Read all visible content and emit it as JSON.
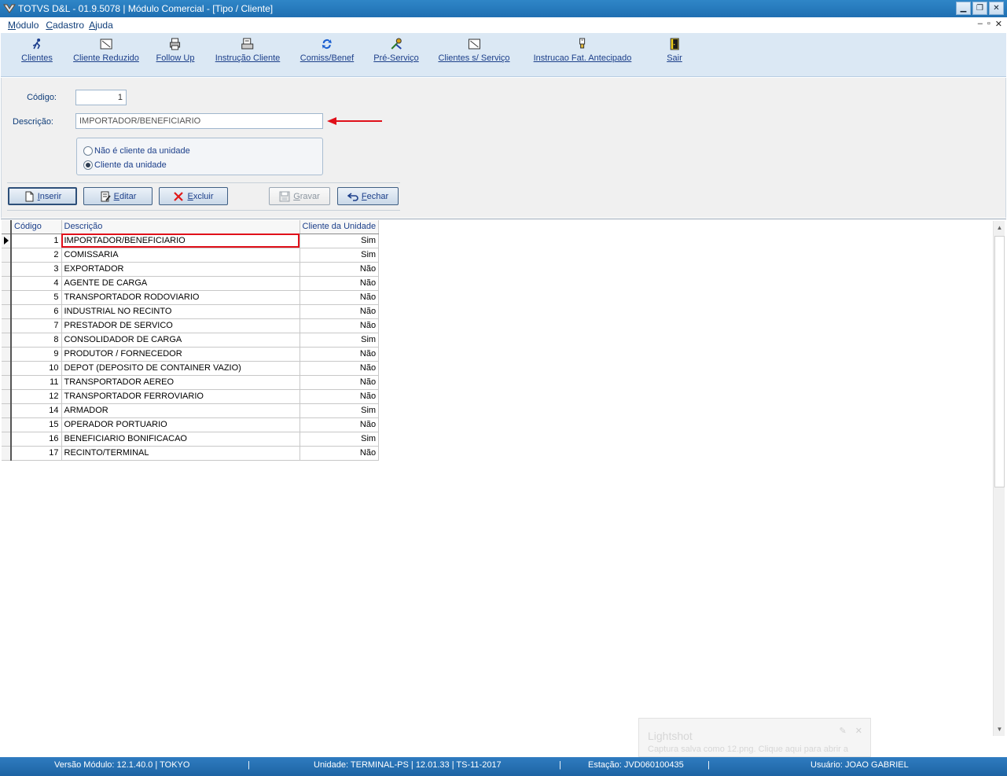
{
  "window": {
    "title": "TOTVS D&L - 01.9.5078 | Módulo Comercial - [Tipo / Cliente]",
    "buttons": {
      "minimize": "▁",
      "restore": "❐",
      "close": "✕"
    }
  },
  "menu": {
    "items": [
      {
        "accel": "M",
        "rest": "ódulo"
      },
      {
        "accel": "C",
        "rest": "adastro"
      },
      {
        "accel": "A",
        "rest": "juda"
      }
    ],
    "mdi": {
      "minimize": "–",
      "restore": "▫",
      "close": "✕"
    }
  },
  "toolbar": {
    "items": [
      {
        "label": "Clientes",
        "icon": "person-run-icon"
      },
      {
        "label": "Cliente Reduzido",
        "icon": "window-icon"
      },
      {
        "label": "Follow Up",
        "icon": "printer-icon"
      },
      {
        "label": "Instrução Cliente",
        "icon": "document-print-icon"
      },
      {
        "label": "Comiss/Benef",
        "icon": "refresh-icon"
      },
      {
        "label": "Pré-Serviço",
        "icon": "tools-icon"
      },
      {
        "label": "Clientes s/ Serviço",
        "icon": "window-icon"
      },
      {
        "label": "Instrucao Fat. Antecipado",
        "icon": "stamp-icon"
      },
      {
        "label": "Sair",
        "icon": "exit-door-icon"
      }
    ]
  },
  "form": {
    "codigo_label": "Código:",
    "codigo_value": "1",
    "descricao_label": "Descrição:",
    "descricao_value": "IMPORTADOR/BENEFICIARIO",
    "radio_options": [
      {
        "label": "Não é cliente da unidade",
        "checked": false
      },
      {
        "label": "Cliente da unidade",
        "checked": true
      }
    ]
  },
  "actions": {
    "inserir": {
      "accel": "I",
      "rest": "nserir"
    },
    "editar": {
      "accel": "E",
      "rest": "ditar"
    },
    "excluir": {
      "accel": "E",
      "rest": "xcluir"
    },
    "gravar": {
      "accel": "G",
      "rest": "ravar"
    },
    "fechar": {
      "accel": "F",
      "rest": "echar"
    }
  },
  "grid": {
    "columns": [
      "Código",
      "Descrição",
      "Cliente da Unidade"
    ],
    "rows": [
      {
        "codigo": "1",
        "descricao": "IMPORTADOR/BENEFICIARIO",
        "cliente": "Sim"
      },
      {
        "codigo": "2",
        "descricao": "COMISSARIA",
        "cliente": "Sim"
      },
      {
        "codigo": "3",
        "descricao": "EXPORTADOR",
        "cliente": "Não"
      },
      {
        "codigo": "4",
        "descricao": "AGENTE DE CARGA",
        "cliente": "Não"
      },
      {
        "codigo": "5",
        "descricao": "TRANSPORTADOR RODOVIARIO",
        "cliente": "Não"
      },
      {
        "codigo": "6",
        "descricao": "INDUSTRIAL NO RECINTO",
        "cliente": "Não"
      },
      {
        "codigo": "7",
        "descricao": "PRESTADOR DE SERVICO",
        "cliente": "Não"
      },
      {
        "codigo": "8",
        "descricao": "CONSOLIDADOR DE CARGA",
        "cliente": "Sim"
      },
      {
        "codigo": "9",
        "descricao": "PRODUTOR / FORNECEDOR",
        "cliente": "Não"
      },
      {
        "codigo": "10",
        "descricao": "DEPOT (DEPOSITO DE CONTAINER VAZIO)",
        "cliente": "Não"
      },
      {
        "codigo": "11",
        "descricao": "TRANSPORTADOR AEREO",
        "cliente": "Não"
      },
      {
        "codigo": "12",
        "descricao": "TRANSPORTADOR FERROVIARIO",
        "cliente": "Não"
      },
      {
        "codigo": "14",
        "descricao": "ARMADOR",
        "cliente": "Sim"
      },
      {
        "codigo": "15",
        "descricao": "OPERADOR PORTUARIO",
        "cliente": "Não"
      },
      {
        "codigo": "16",
        "descricao": "BENEFICIARIO BONIFICACAO",
        "cliente": "Sim"
      },
      {
        "codigo": "17",
        "descricao": "RECINTO/TERMINAL",
        "cliente": "Não"
      }
    ]
  },
  "notification": {
    "title": "Lightshot",
    "text": "Captura salva como 12.png. Clique aqui para abrir a"
  },
  "statusbar": {
    "versao": "Versão Módulo:  12.1.40.0  |  TOKYO",
    "sep1": "|",
    "unidade": "Unidade: TERMINAL-PS | 12.01.33 | TS-11-2017",
    "sep2": "|",
    "estacao": "Estação: JVD060100435",
    "sep3": "|",
    "usuario": "Usuário: JOAO GABRIEL"
  },
  "colors": {
    "accent_blue": "#1f6fb2",
    "label_blue": "#0f3d79",
    "highlight_red": "#e0101a"
  }
}
